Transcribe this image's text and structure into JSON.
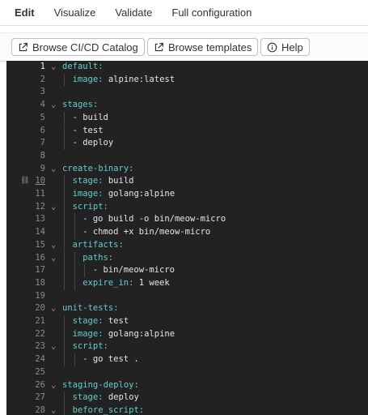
{
  "tabs": [
    "Edit",
    "Visualize",
    "Validate",
    "Full configuration"
  ],
  "toolbar": {
    "catalog_label": "Browse CI/CD Catalog",
    "templates_label": "Browse templates",
    "help_label": "Help"
  },
  "editor": {
    "lines": [
      {
        "n": "1",
        "indent": 0,
        "key": "default:",
        "val": "",
        "fold": true
      },
      {
        "n": "2",
        "indent": 1,
        "key": "image:",
        "val": " alpine:latest",
        "fold": false
      },
      {
        "n": "3",
        "indent": 0,
        "key": "",
        "val": "",
        "fold": false
      },
      {
        "n": "4",
        "indent": 0,
        "key": "stages:",
        "val": "",
        "fold": true
      },
      {
        "n": "5",
        "indent": 1,
        "key": "",
        "val": "- build",
        "fold": false
      },
      {
        "n": "6",
        "indent": 1,
        "key": "",
        "val": "- test",
        "fold": false
      },
      {
        "n": "7",
        "indent": 1,
        "key": "",
        "val": "- deploy",
        "fold": false
      },
      {
        "n": "8",
        "indent": 0,
        "key": "",
        "val": "",
        "fold": false
      },
      {
        "n": "9",
        "indent": 0,
        "key": "create-binary:",
        "val": "",
        "fold": true
      },
      {
        "n": "10",
        "indent": 1,
        "key": "stage:",
        "val": " build",
        "fold": false,
        "link": true
      },
      {
        "n": "11",
        "indent": 1,
        "key": "image:",
        "val": " golang:alpine",
        "fold": false
      },
      {
        "n": "12",
        "indent": 1,
        "key": "script:",
        "val": "",
        "fold": true
      },
      {
        "n": "13",
        "indent": 2,
        "key": "",
        "val": "- go build -o bin/meow-micro",
        "fold": false
      },
      {
        "n": "14",
        "indent": 2,
        "key": "",
        "val": "- chmod +x bin/meow-micro",
        "fold": false
      },
      {
        "n": "15",
        "indent": 1,
        "key": "artifacts:",
        "val": "",
        "fold": true
      },
      {
        "n": "16",
        "indent": 2,
        "key": "paths:",
        "val": "",
        "fold": true
      },
      {
        "n": "17",
        "indent": 3,
        "key": "",
        "val": "- bin/meow-micro",
        "fold": false
      },
      {
        "n": "18",
        "indent": 2,
        "key": "expire_in:",
        "val": " 1 week",
        "fold": false
      },
      {
        "n": "19",
        "indent": 0,
        "key": "",
        "val": "",
        "fold": false
      },
      {
        "n": "20",
        "indent": 0,
        "key": "unit-tests:",
        "val": "",
        "fold": true
      },
      {
        "n": "21",
        "indent": 1,
        "key": "stage:",
        "val": " test",
        "fold": false
      },
      {
        "n": "22",
        "indent": 1,
        "key": "image:",
        "val": " golang:alpine",
        "fold": false
      },
      {
        "n": "23",
        "indent": 1,
        "key": "script:",
        "val": "",
        "fold": true
      },
      {
        "n": "24",
        "indent": 2,
        "key": "",
        "val": "- go test .",
        "fold": false
      },
      {
        "n": "25",
        "indent": 0,
        "key": "",
        "val": "",
        "fold": false
      },
      {
        "n": "26",
        "indent": 0,
        "key": "staging-deploy:",
        "val": "",
        "fold": true
      },
      {
        "n": "27",
        "indent": 1,
        "key": "stage:",
        "val": " deploy",
        "fold": false
      },
      {
        "n": "28",
        "indent": 1,
        "key": "before_script:",
        "val": "",
        "fold": true
      }
    ],
    "active_line": "1",
    "colors": {
      "key": "#66cccc",
      "value": "#e6e6e6",
      "background": "#222222"
    }
  }
}
